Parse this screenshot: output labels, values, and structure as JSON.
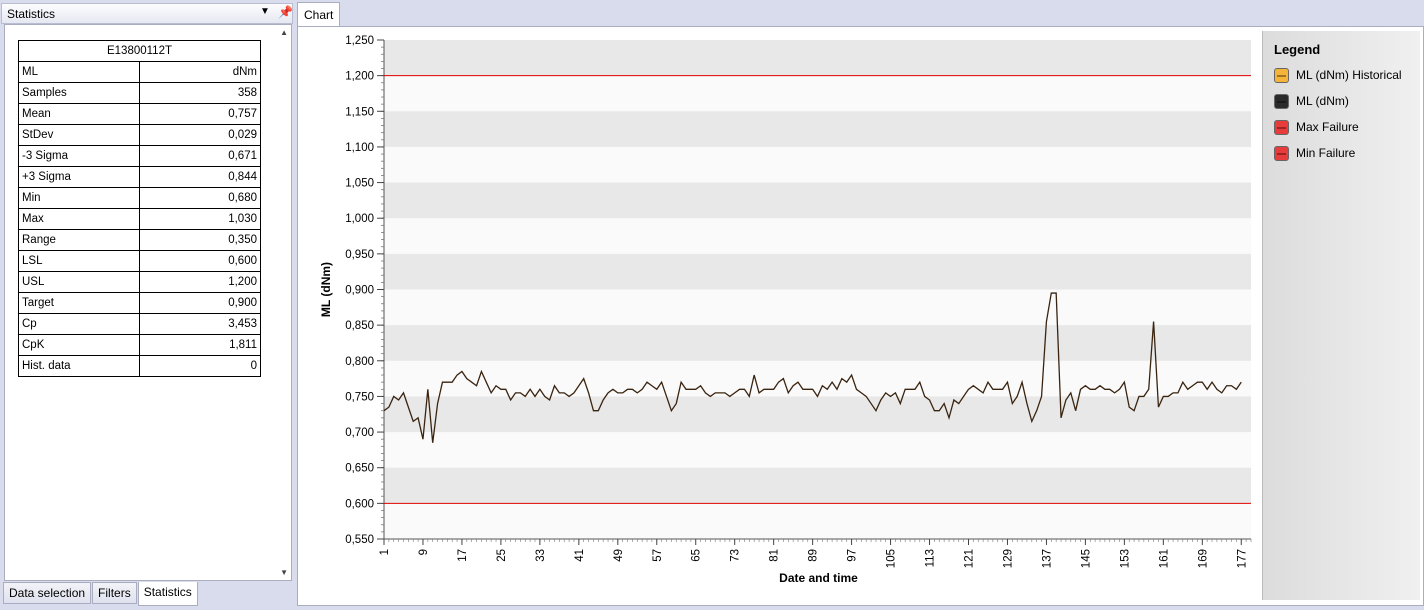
{
  "stats_pane": {
    "title": "Statistics",
    "table_header": "E13800112T",
    "rows": [
      {
        "label": "ML",
        "value": "dNm"
      },
      {
        "label": "Samples",
        "value": "358"
      },
      {
        "label": "Mean",
        "value": "0,757"
      },
      {
        "label": "StDev",
        "value": "0,029"
      },
      {
        "label": "-3 Sigma",
        "value": "0,671"
      },
      {
        "label": "+3 Sigma",
        "value": "0,844"
      },
      {
        "label": "Min",
        "value": "0,680"
      },
      {
        "label": "Max",
        "value": "1,030"
      },
      {
        "label": "Range",
        "value": "0,350"
      },
      {
        "label": "LSL",
        "value": "0,600"
      },
      {
        "label": "USL",
        "value": "1,200"
      },
      {
        "label": "Target",
        "value": "0,900"
      },
      {
        "label": "Cp",
        "value": "3,453"
      },
      {
        "label": "CpK",
        "value": "1,811"
      },
      {
        "label": "Hist. data",
        "value": "0"
      }
    ],
    "tabs": [
      "Data selection",
      "Filters",
      "Statistics"
    ],
    "active_tab": "Statistics"
  },
  "chart_tab": {
    "label": "Chart"
  },
  "legend": {
    "title": "Legend",
    "items": [
      {
        "label": "ML (dNm) Historical",
        "color": "#f4b43a"
      },
      {
        "label": "ML (dNm)",
        "color": "#2a2a2a"
      },
      {
        "label": "Max Failure",
        "color": "#e83c3c"
      },
      {
        "label": "Min Failure",
        "color": "#e83c3c"
      }
    ]
  },
  "chart_data": {
    "type": "line",
    "xlabel": "Date and time",
    "ylabel": "ML (dNm)",
    "ylim": [
      0.55,
      1.25
    ],
    "y_ticks": [
      "0,550",
      "0,600",
      "0,650",
      "0,700",
      "0,750",
      "0,800",
      "0,850",
      "0,900",
      "0,950",
      "1,000",
      "1,050",
      "1,100",
      "1,150",
      "1,200",
      "1,250"
    ],
    "x_ticks": [
      "1",
      "9",
      "17",
      "25",
      "33",
      "41",
      "49",
      "57",
      "65",
      "73",
      "81",
      "89",
      "97",
      "105",
      "113",
      "121",
      "129",
      "137",
      "145",
      "153",
      "161",
      "169",
      "177"
    ],
    "xlim": [
      1,
      179
    ],
    "limit_lines": [
      {
        "name": "Max Failure",
        "value": 1.2,
        "color": "#e00000"
      },
      {
        "name": "Min Failure",
        "value": 0.6,
        "color": "#e00000"
      }
    ],
    "line_color": "#3a2410",
    "band_color": "#e8e8e8",
    "series": [
      {
        "name": "ML (dNm)",
        "values": [
          0.73,
          0.735,
          0.75,
          0.745,
          0.755,
          0.735,
          0.715,
          0.72,
          0.69,
          0.76,
          0.685,
          0.74,
          0.77,
          0.77,
          0.77,
          0.78,
          0.785,
          0.775,
          0.77,
          0.765,
          0.785,
          0.77,
          0.755,
          0.765,
          0.76,
          0.76,
          0.745,
          0.755,
          0.755,
          0.75,
          0.76,
          0.75,
          0.76,
          0.75,
          0.745,
          0.765,
          0.755,
          0.755,
          0.75,
          0.755,
          0.765,
          0.775,
          0.755,
          0.73,
          0.73,
          0.745,
          0.755,
          0.76,
          0.755,
          0.755,
          0.76,
          0.76,
          0.755,
          0.76,
          0.77,
          0.765,
          0.76,
          0.77,
          0.75,
          0.73,
          0.74,
          0.77,
          0.76,
          0.76,
          0.76,
          0.765,
          0.755,
          0.75,
          0.755,
          0.755,
          0.755,
          0.75,
          0.755,
          0.76,
          0.76,
          0.75,
          0.78,
          0.755,
          0.76,
          0.76,
          0.76,
          0.77,
          0.775,
          0.755,
          0.765,
          0.77,
          0.76,
          0.76,
          0.76,
          0.75,
          0.765,
          0.76,
          0.77,
          0.76,
          0.775,
          0.77,
          0.78,
          0.76,
          0.755,
          0.75,
          0.74,
          0.73,
          0.745,
          0.755,
          0.75,
          0.755,
          0.74,
          0.76,
          0.76,
          0.76,
          0.77,
          0.75,
          0.745,
          0.73,
          0.73,
          0.74,
          0.72,
          0.745,
          0.74,
          0.75,
          0.76,
          0.765,
          0.76,
          0.755,
          0.77,
          0.76,
          0.76,
          0.76,
          0.77,
          0.74,
          0.75,
          0.77,
          0.74,
          0.715,
          0.73,
          0.75,
          0.855,
          0.895,
          0.895,
          0.72,
          0.745,
          0.755,
          0.73,
          0.76,
          0.765,
          0.76,
          0.76,
          0.765,
          0.76,
          0.76,
          0.755,
          0.76,
          0.77,
          0.735,
          0.73,
          0.75,
          0.75,
          0.76,
          0.855,
          0.735,
          0.75,
          0.75,
          0.755,
          0.755,
          0.77,
          0.76,
          0.765,
          0.77,
          0.77,
          0.76,
          0.77,
          0.76,
          0.755,
          0.765,
          0.765,
          0.76,
          0.77
        ]
      }
    ]
  }
}
